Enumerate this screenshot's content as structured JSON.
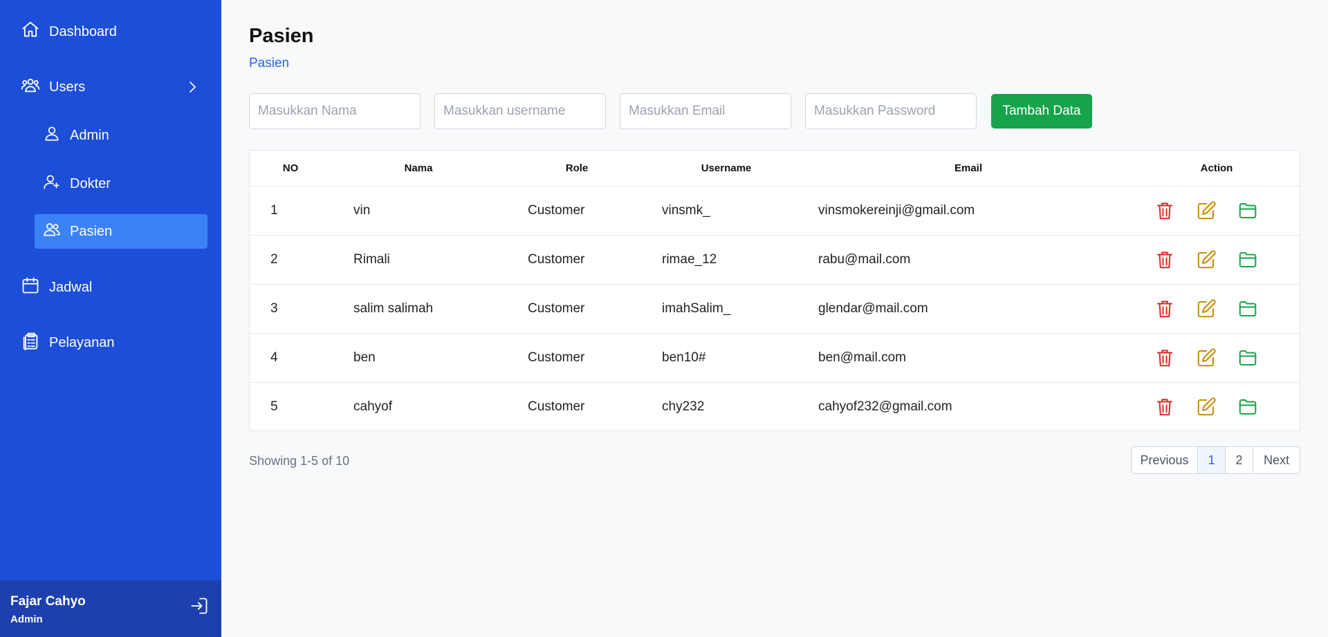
{
  "sidebar": {
    "items": [
      {
        "label": "Dashboard",
        "icon": "home-icon"
      },
      {
        "label": "Users",
        "icon": "users-icon",
        "expanded": true,
        "children": [
          {
            "label": "Admin",
            "icon": "user-icon"
          },
          {
            "label": "Dokter",
            "icon": "user-plus-icon"
          },
          {
            "label": "Pasien",
            "icon": "users-icon",
            "active": true
          }
        ]
      },
      {
        "label": "Jadwal",
        "icon": "calendar-icon"
      },
      {
        "label": "Pelayanan",
        "icon": "clipboard-icon"
      }
    ],
    "user": {
      "name": "Fajar Cahyo",
      "role": "Admin"
    },
    "color": "#1d4ed8",
    "active_color": "#3b82f6"
  },
  "page": {
    "title": "Pasien",
    "breadcrumb": "Pasien"
  },
  "form": {
    "nama_placeholder": "Masukkan Nama",
    "username_placeholder": "Masukkan username",
    "email_placeholder": "Masukkan Email",
    "password_placeholder": "Masukkan Password",
    "submit_label": "Tambah Data"
  },
  "table": {
    "headers": [
      "NO",
      "Nama",
      "Role",
      "Username",
      "Email",
      "Action"
    ],
    "rows": [
      {
        "no": "1",
        "nama": "vin",
        "role": "Customer",
        "username": "vinsmk_",
        "email": "vinsmokereinji@gmail.com"
      },
      {
        "no": "2",
        "nama": "Rimali",
        "role": "Customer",
        "username": "rimae_12",
        "email": "rabu@mail.com"
      },
      {
        "no": "3",
        "nama": "salim salimah",
        "role": "Customer",
        "username": "imahSalim_",
        "email": "glendar@mail.com"
      },
      {
        "no": "4",
        "nama": "ben",
        "role": "Customer",
        "username": "ben10#",
        "email": "ben@mail.com"
      },
      {
        "no": "5",
        "nama": "cahyof",
        "role": "Customer",
        "username": "chy232",
        "email": "cahyof232@gmail.com"
      }
    ],
    "action_icons": [
      "trash-icon",
      "edit-icon",
      "folder-icon"
    ]
  },
  "pagination": {
    "showing": "Showing 1-5 of 10",
    "previous": "Previous",
    "pages": [
      "1",
      "2"
    ],
    "current": "1",
    "next": "Next"
  },
  "colors": {
    "primary": "#1d4ed8",
    "success": "#16a34a",
    "danger": "#dc2626",
    "warning": "#ca8a04"
  }
}
